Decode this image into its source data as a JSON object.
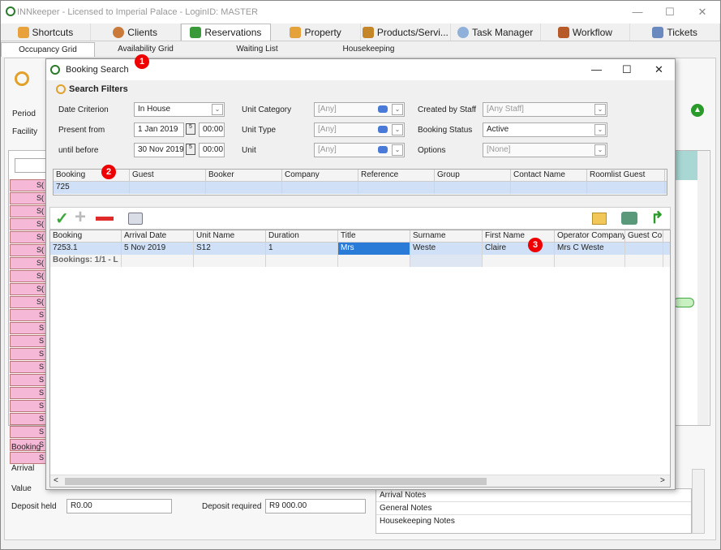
{
  "window": {
    "title": "INNkeeper - Licensed to Imperial Palace - LoginID: MASTER"
  },
  "main_tabs": [
    {
      "label": "Shortcuts",
      "icon": "shortcuts-icon"
    },
    {
      "label": "Clients",
      "icon": "clients-icon"
    },
    {
      "label": "Reservations",
      "icon": "reservations-icon"
    },
    {
      "label": "Property",
      "icon": "property-icon"
    },
    {
      "label": "Products/Servi...",
      "icon": "products-icon"
    },
    {
      "label": "Task Manager",
      "icon": "task-manager-icon"
    },
    {
      "label": "Workflow",
      "icon": "workflow-icon"
    },
    {
      "label": "Tickets",
      "icon": "tickets-icon"
    }
  ],
  "sub_tabs": [
    "Occupancy Grid",
    "Availability Grid",
    "Waiting List",
    "Housekeeping"
  ],
  "background": {
    "period_label": "Period",
    "facility_label": "Facility",
    "pink_cells": [
      "S(",
      "S(",
      "S(",
      "S(",
      "S(",
      "S(",
      "S(",
      "S(",
      "S(",
      "S(",
      "S",
      "S",
      "S",
      "S",
      "S",
      "S",
      "S",
      "S",
      "S",
      "S",
      "S",
      "S"
    ],
    "booking_label": "Booking",
    "arrival_label": "Arrival",
    "value_label": "Value",
    "deposit_held_label": "Deposit held",
    "deposit_held_value": "R0.00",
    "deposit_required_label": "Deposit required",
    "deposit_required_value": "R9 000.00",
    "notes": [
      "Arrival Notes",
      "General Notes",
      "Housekeeping Notes"
    ]
  },
  "dialog": {
    "title": "Booking Search",
    "filters_title": "Search Filters",
    "date_criterion_label": "Date Criterion",
    "date_criterion_value": "In House",
    "present_from_label": "Present from",
    "present_from_date": "1 Jan 2019",
    "present_from_time": "00:00",
    "until_before_label": "until before",
    "until_before_date": "30 Nov 2019",
    "until_before_time": "00:00",
    "unit_category_label": "Unit Category",
    "unit_category_value": "[Any]",
    "unit_type_label": "Unit Type",
    "unit_type_value": "[Any]",
    "unit_label": "Unit",
    "unit_value": "[Any]",
    "created_by_label": "Created by Staff",
    "created_by_value": "[Any Staff]",
    "booking_status_label": "Booking Status",
    "booking_status_value": "Active",
    "options_label": "Options",
    "options_value": "[None]",
    "filter_grid": {
      "columns": [
        "Booking",
        "Guest",
        "Booker",
        "Company",
        "Reference",
        "Group",
        "Contact Name",
        "Roomlist Guest"
      ],
      "values": [
        "725",
        "",
        "",
        "",
        "",
        "",
        "",
        ""
      ]
    },
    "results": {
      "columns": [
        "Booking",
        "Arrival Date",
        "Unit Name",
        "Duration",
        "Title",
        "Surname",
        "First Name",
        "Operator Company",
        "Guest Com"
      ],
      "rows": [
        [
          "7253.1",
          "5 Nov 2019",
          "S12",
          "1",
          "Mrs",
          "Weste",
          "Claire",
          "Mrs C Weste",
          ""
        ]
      ],
      "footer": "Bookings: 1/1 - L"
    }
  },
  "badges": [
    "1",
    "2",
    "3"
  ]
}
